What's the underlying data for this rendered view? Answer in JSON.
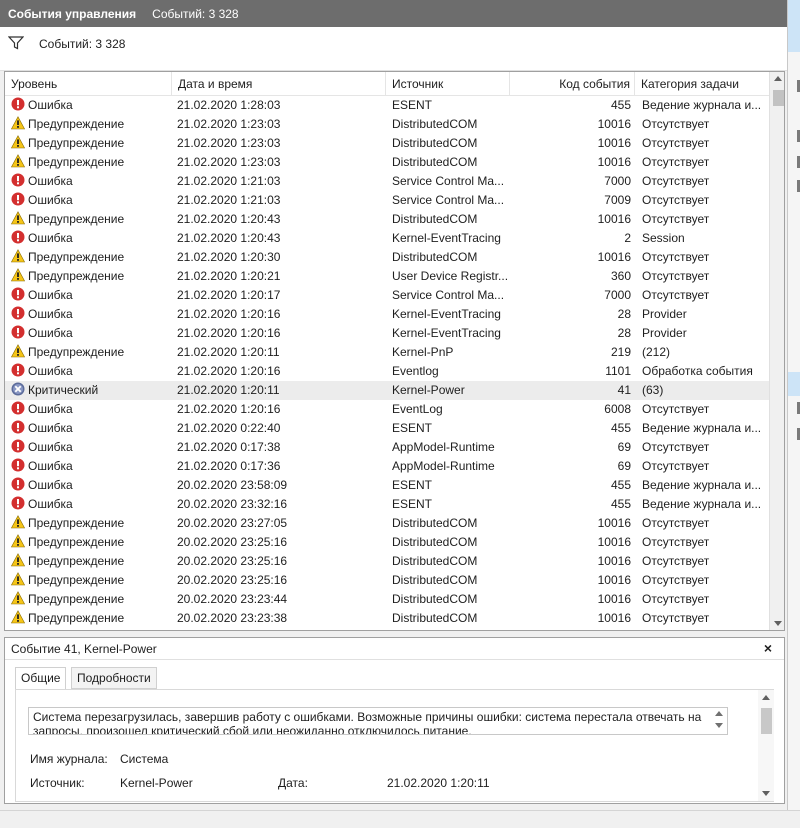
{
  "title": {
    "label": "События управления",
    "count": "Событий: 3 328"
  },
  "toolbar": {
    "filter_icon": "filter-icon",
    "count": "Событий: 3 328"
  },
  "columns": {
    "level": "Уровень",
    "date": "Дата и время",
    "source": "Источник",
    "code": "Код события",
    "category": "Категория задачи"
  },
  "colors": {
    "error": "#d32f2f",
    "warning": "#f5c518",
    "critical": "#5b6b9a",
    "selected_row": "#ececec",
    "titlebar": "#6d6d6d"
  },
  "rows": [
    {
      "level": "Ошибка",
      "icon": "error-icon",
      "date": "21.02.2020 1:28:03",
      "source": "ESENT",
      "code": "455",
      "category": "Ведение журнала и..."
    },
    {
      "level": "Предупреждение",
      "icon": "warning-icon",
      "date": "21.02.2020 1:23:03",
      "source": "DistributedCOM",
      "code": "10016",
      "category": "Отсутствует"
    },
    {
      "level": "Предупреждение",
      "icon": "warning-icon",
      "date": "21.02.2020 1:23:03",
      "source": "DistributedCOM",
      "code": "10016",
      "category": "Отсутствует"
    },
    {
      "level": "Предупреждение",
      "icon": "warning-icon",
      "date": "21.02.2020 1:23:03",
      "source": "DistributedCOM",
      "code": "10016",
      "category": "Отсутствует"
    },
    {
      "level": "Ошибка",
      "icon": "error-icon",
      "date": "21.02.2020 1:21:03",
      "source": "Service Control Ma...",
      "code": "7000",
      "category": "Отсутствует"
    },
    {
      "level": "Ошибка",
      "icon": "error-icon",
      "date": "21.02.2020 1:21:03",
      "source": "Service Control Ma...",
      "code": "7009",
      "category": "Отсутствует"
    },
    {
      "level": "Предупреждение",
      "icon": "warning-icon",
      "date": "21.02.2020 1:20:43",
      "source": "DistributedCOM",
      "code": "10016",
      "category": "Отсутствует"
    },
    {
      "level": "Ошибка",
      "icon": "error-icon",
      "date": "21.02.2020 1:20:43",
      "source": "Kernel-EventTracing",
      "code": "2",
      "category": "Session"
    },
    {
      "level": "Предупреждение",
      "icon": "warning-icon",
      "date": "21.02.2020 1:20:30",
      "source": "DistributedCOM",
      "code": "10016",
      "category": "Отсутствует"
    },
    {
      "level": "Предупреждение",
      "icon": "warning-icon",
      "date": "21.02.2020 1:20:21",
      "source": "User Device Registr...",
      "code": "360",
      "category": "Отсутствует"
    },
    {
      "level": "Ошибка",
      "icon": "error-icon",
      "date": "21.02.2020 1:20:17",
      "source": "Service Control Ma...",
      "code": "7000",
      "category": "Отсутствует"
    },
    {
      "level": "Ошибка",
      "icon": "error-icon",
      "date": "21.02.2020 1:20:16",
      "source": "Kernel-EventTracing",
      "code": "28",
      "category": "Provider"
    },
    {
      "level": "Ошибка",
      "icon": "error-icon",
      "date": "21.02.2020 1:20:16",
      "source": "Kernel-EventTracing",
      "code": "28",
      "category": "Provider"
    },
    {
      "level": "Предупреждение",
      "icon": "warning-icon",
      "date": "21.02.2020 1:20:11",
      "source": "Kernel-PnP",
      "code": "219",
      "category": "(212)"
    },
    {
      "level": "Ошибка",
      "icon": "error-icon",
      "date": "21.02.2020 1:20:16",
      "source": "Eventlog",
      "code": "1101",
      "category": "Обработка события"
    },
    {
      "level": "Критический",
      "icon": "critical-icon",
      "date": "21.02.2020 1:20:11",
      "source": "Kernel-Power",
      "code": "41",
      "category": "(63)",
      "selected": true
    },
    {
      "level": "Ошибка",
      "icon": "error-icon",
      "date": "21.02.2020 1:20:16",
      "source": "EventLog",
      "code": "6008",
      "category": "Отсутствует"
    },
    {
      "level": "Ошибка",
      "icon": "error-icon",
      "date": "21.02.2020 0:22:40",
      "source": "ESENT",
      "code": "455",
      "category": "Ведение журнала и..."
    },
    {
      "level": "Ошибка",
      "icon": "error-icon",
      "date": "21.02.2020 0:17:38",
      "source": "AppModel-Runtime",
      "code": "69",
      "category": "Отсутствует"
    },
    {
      "level": "Ошибка",
      "icon": "error-icon",
      "date": "21.02.2020 0:17:36",
      "source": "AppModel-Runtime",
      "code": "69",
      "category": "Отсутствует"
    },
    {
      "level": "Ошибка",
      "icon": "error-icon",
      "date": "20.02.2020 23:58:09",
      "source": "ESENT",
      "code": "455",
      "category": "Ведение журнала и..."
    },
    {
      "level": "Ошибка",
      "icon": "error-icon",
      "date": "20.02.2020 23:32:16",
      "source": "ESENT",
      "code": "455",
      "category": "Ведение журнала и..."
    },
    {
      "level": "Предупреждение",
      "icon": "warning-icon",
      "date": "20.02.2020 23:27:05",
      "source": "DistributedCOM",
      "code": "10016",
      "category": "Отсутствует"
    },
    {
      "level": "Предупреждение",
      "icon": "warning-icon",
      "date": "20.02.2020 23:25:16",
      "source": "DistributedCOM",
      "code": "10016",
      "category": "Отсутствует"
    },
    {
      "level": "Предупреждение",
      "icon": "warning-icon",
      "date": "20.02.2020 23:25:16",
      "source": "DistributedCOM",
      "code": "10016",
      "category": "Отсутствует"
    },
    {
      "level": "Предупреждение",
      "icon": "warning-icon",
      "date": "20.02.2020 23:25:16",
      "source": "DistributedCOM",
      "code": "10016",
      "category": "Отсутствует"
    },
    {
      "level": "Предупреждение",
      "icon": "warning-icon",
      "date": "20.02.2020 23:23:44",
      "source": "DistributedCOM",
      "code": "10016",
      "category": "Отсутствует"
    },
    {
      "level": "Предупреждение",
      "icon": "warning-icon",
      "date": "20.02.2020 23:23:38",
      "source": "DistributedCOM",
      "code": "10016",
      "category": "Отсутствует"
    }
  ],
  "detail": {
    "header": "Событие 41, Kernel-Power",
    "close": "×",
    "tabs": [
      "Общие",
      "Подробности"
    ],
    "description": "Система перезагрузилась, завершив работу с ошибками. Возможные причины ошибки: система перестала отвечать на запросы, произошел критический сбой или неожиданно отключилось питание.",
    "log_label": "Имя журнала:",
    "log_value": "Система",
    "source_label": "Источник:",
    "source_value": "Kernel-Power",
    "date_label": "Дата:",
    "date_value": "21.02.2020 1:20:11"
  }
}
